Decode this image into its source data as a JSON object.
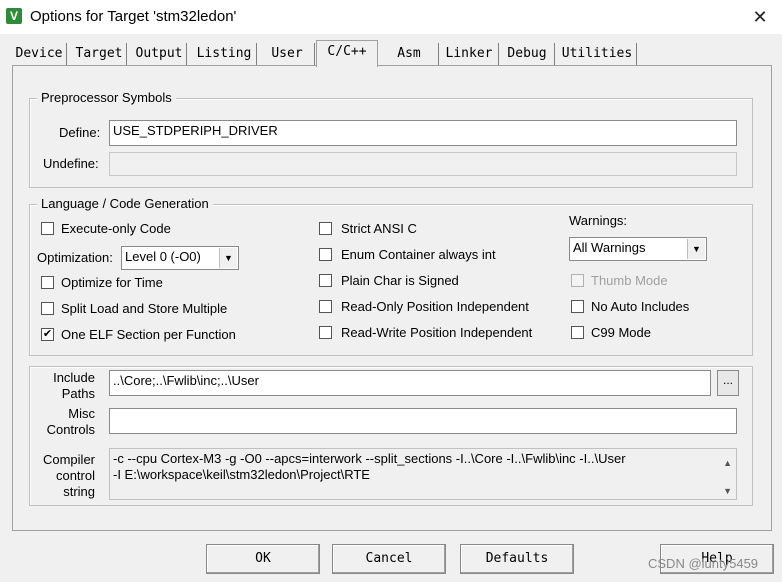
{
  "window": {
    "title": "Options for Target 'stm32ledon'",
    "app_icon": "keil-icon",
    "close": "✕"
  },
  "tabs": [
    "Device",
    "Target",
    "Output",
    "Listing",
    "User",
    "C/C++",
    "Asm",
    "Linker",
    "Debug",
    "Utilities"
  ],
  "active_tab": "C/C++",
  "preprocessor": {
    "group_title": "Preprocessor Symbols",
    "define_label": "Define:",
    "define_value": "USE_STDPERIPH_DRIVER",
    "undefine_label": "Undefine:",
    "undefine_value": ""
  },
  "language": {
    "group_title": "Language / Code Generation",
    "execute_only": {
      "label": "Execute-only Code",
      "checked": false
    },
    "optimization_label": "Optimization:",
    "optimization_value": "Level 0 (-O0)",
    "optimize_time": {
      "label": "Optimize for Time",
      "checked": false
    },
    "split_load": {
      "label": "Split Load and Store Multiple",
      "checked": false
    },
    "one_elf": {
      "label": "One ELF Section per Function",
      "checked": true
    },
    "strict_ansi": {
      "label": "Strict ANSI C",
      "checked": false
    },
    "enum_container": {
      "label": "Enum Container always int",
      "checked": false
    },
    "plain_char": {
      "label": "Plain Char is Signed",
      "checked": false
    },
    "ro_position": {
      "label": "Read-Only Position Independent",
      "checked": false
    },
    "rw_position": {
      "label": "Read-Write Position Independent",
      "checked": false
    },
    "warnings_label": "Warnings:",
    "warnings_value": "All Warnings",
    "thumb_mode": {
      "label": "Thumb Mode",
      "checked": false,
      "disabled": true
    },
    "no_auto_includes": {
      "label": "No Auto Includes",
      "checked": false
    },
    "c99_mode": {
      "label": "C99 Mode",
      "checked": false
    }
  },
  "include": {
    "label_line1": "Include",
    "label_line2": "Paths",
    "value": "..\\Core;..\\Fwlib\\inc;..\\User",
    "browse": "..."
  },
  "misc": {
    "label_line1": "Misc",
    "label_line2": "Controls",
    "value": ""
  },
  "compiler": {
    "label_line1": "Compiler",
    "label_line2": "control",
    "label_line3": "string",
    "line1": "-c --cpu Cortex-M3 -g -O0 --apcs=interwork --split_sections -I..\\Core -I..\\Fwlib\\inc -I..\\User",
    "line2": "-I E:\\workspace\\keil\\stm32ledon\\Project\\RTE"
  },
  "buttons": {
    "ok": "OK",
    "cancel": "Cancel",
    "defaults": "Defaults",
    "help": "Help"
  },
  "watermark": "CSDN @lunty5459"
}
